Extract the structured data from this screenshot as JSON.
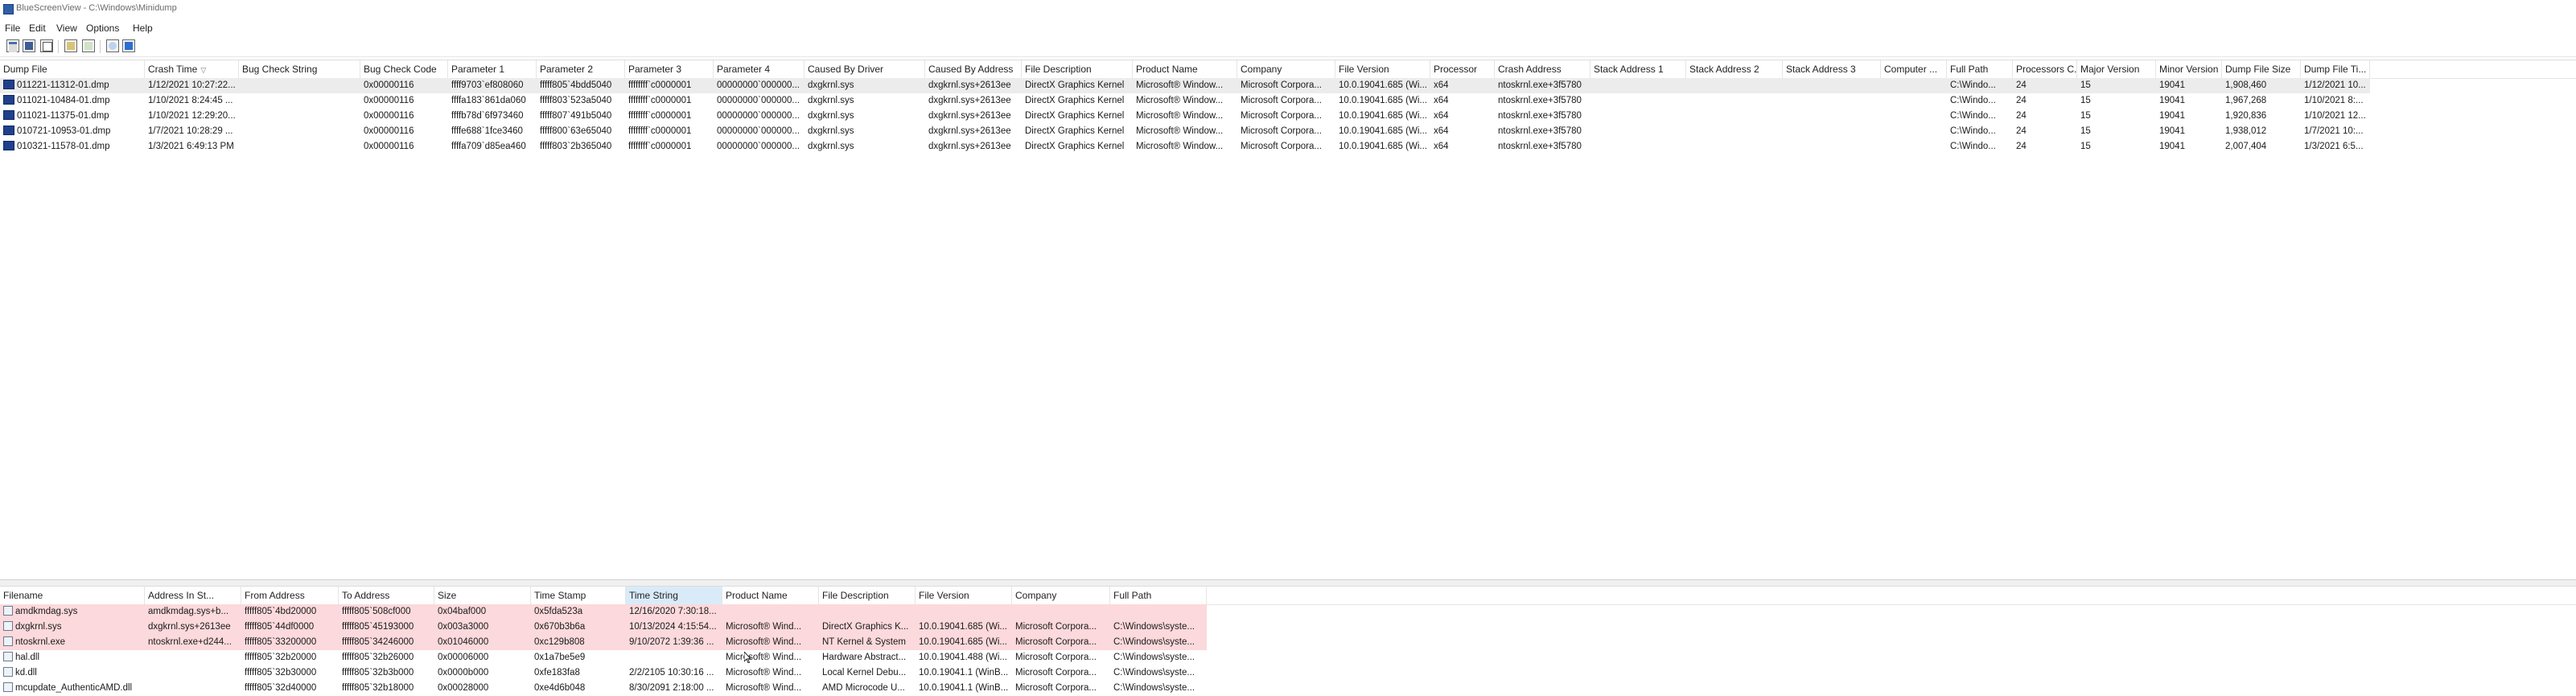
{
  "window": {
    "title": "BlueScreenView  -  C:\\Windows\\Minidump"
  },
  "menu": [
    "File",
    "Edit",
    "View",
    "Options",
    "Help"
  ],
  "toolbar": {
    "icons": [
      "properties-icon",
      "save-icon",
      "copy-icon",
      "html-report-icon",
      "refresh-icon",
      "find-icon",
      "about-icon"
    ]
  },
  "top_table": {
    "sort_column": "Crash Time",
    "columns": [
      "Dump File",
      "Crash Time",
      "Bug Check String",
      "Bug Check Code",
      "Parameter 1",
      "Parameter 2",
      "Parameter 3",
      "Parameter 4",
      "Caused By Driver",
      "Caused By Address",
      "File Description",
      "Product Name",
      "Company",
      "File Version",
      "Processor",
      "Crash Address",
      "Stack Address 1",
      "Stack Address 2",
      "Stack Address 3",
      "Computer ...",
      "Full Path",
      "Processors C...",
      "Major Version",
      "Minor Version",
      "Dump File Size",
      "Dump File Ti..."
    ],
    "rows": [
      [
        "011221-11312-01.dmp",
        "1/12/2021 10:27:22...",
        "",
        "0x00000116",
        "ffff9703`ef808060",
        "fffff805`4bdd5040",
        "ffffffff`c0000001",
        "00000000`000000...",
        "dxgkrnl.sys",
        "dxgkrnl.sys+2613ee",
        "DirectX Graphics Kernel",
        "Microsoft® Window...",
        "Microsoft Corpora...",
        "10.0.19041.685 (Wi...",
        "x64",
        "ntoskrnl.exe+3f5780",
        "",
        "",
        "",
        "",
        "C:\\Windo...",
        "24",
        "15",
        "19041",
        "1,908,460",
        "1/12/2021 10..."
      ],
      [
        "011021-10484-01.dmp",
        "1/10/2021 8:24:45 ...",
        "",
        "0x00000116",
        "ffffa183`861da060",
        "fffff803`523a5040",
        "ffffffff`c0000001",
        "00000000`000000...",
        "dxgkrnl.sys",
        "dxgkrnl.sys+2613ee",
        "DirectX Graphics Kernel",
        "Microsoft® Window...",
        "Microsoft Corpora...",
        "10.0.19041.685 (Wi...",
        "x64",
        "ntoskrnl.exe+3f5780",
        "",
        "",
        "",
        "",
        "C:\\Windo...",
        "24",
        "15",
        "19041",
        "1,967,268",
        "1/10/2021 8:..."
      ],
      [
        "011021-11375-01.dmp",
        "1/10/2021 12:29:20...",
        "",
        "0x00000116",
        "ffffb78d`6f973460",
        "fffff807`491b5040",
        "ffffffff`c0000001",
        "00000000`000000...",
        "dxgkrnl.sys",
        "dxgkrnl.sys+2613ee",
        "DirectX Graphics Kernel",
        "Microsoft® Window...",
        "Microsoft Corpora...",
        "10.0.19041.685 (Wi...",
        "x64",
        "ntoskrnl.exe+3f5780",
        "",
        "",
        "",
        "",
        "C:\\Windo...",
        "24",
        "15",
        "19041",
        "1,920,836",
        "1/10/2021 12..."
      ],
      [
        "010721-10953-01.dmp",
        "1/7/2021 10:28:29 ...",
        "",
        "0x00000116",
        "ffffe688`1fce3460",
        "fffff800`63e65040",
        "ffffffff`c0000001",
        "00000000`000000...",
        "dxgkrnl.sys",
        "dxgkrnl.sys+2613ee",
        "DirectX Graphics Kernel",
        "Microsoft® Window...",
        "Microsoft Corpora...",
        "10.0.19041.685 (Wi...",
        "x64",
        "ntoskrnl.exe+3f5780",
        "",
        "",
        "",
        "",
        "C:\\Windo...",
        "24",
        "15",
        "19041",
        "1,938,012",
        "1/7/2021 10:..."
      ],
      [
        "010321-11578-01.dmp",
        "1/3/2021 6:49:13 PM",
        "",
        "0x00000116",
        "ffffa709`d85ea460",
        "fffff803`2b365040",
        "ffffffff`c0000001",
        "00000000`000000...",
        "dxgkrnl.sys",
        "dxgkrnl.sys+2613ee",
        "DirectX Graphics Kernel",
        "Microsoft® Window...",
        "Microsoft Corpora...",
        "10.0.19041.685 (Wi...",
        "x64",
        "ntoskrnl.exe+3f5780",
        "",
        "",
        "",
        "",
        "C:\\Windo...",
        "24",
        "15",
        "19041",
        "2,007,404",
        "1/3/2021 6:5..."
      ]
    ]
  },
  "bottom_table": {
    "sort_column": "Time String",
    "columns": [
      "Filename",
      "Address In St...",
      "From Address",
      "To Address",
      "Size",
      "Time Stamp",
      "Time String",
      "Product Name",
      "File Description",
      "File Version",
      "Company",
      "Full Path"
    ],
    "rows": [
      [
        "amdkmdag.sys",
        "amdkmdag.sys+b...",
        "fffff805`4bd20000",
        "fffff805`508cf000",
        "0x04baf000",
        "0x5fda523a",
        "12/16/2020 7:30:18...",
        "",
        "",
        "",
        "",
        ""
      ],
      [
        "dxgkrnl.sys",
        "dxgkrnl.sys+2613ee",
        "fffff805`44df0000",
        "fffff805`45193000",
        "0x003a3000",
        "0x670b3b6a",
        "10/13/2024 4:15:54...",
        "Microsoft® Wind...",
        "DirectX Graphics K...",
        "10.0.19041.685 (Wi...",
        "Microsoft Corpora...",
        "C:\\Windows\\syste..."
      ],
      [
        "ntoskrnl.exe",
        "ntoskrnl.exe+d244...",
        "fffff805`33200000",
        "fffff805`34246000",
        "0x01046000",
        "0xc129b808",
        "9/10/2072 1:39:36 ...",
        "Microsoft® Wind...",
        "NT Kernel & System",
        "10.0.19041.685 (Wi...",
        "Microsoft Corpora...",
        "C:\\Windows\\syste..."
      ],
      [
        "hal.dll",
        "",
        "fffff805`32b20000",
        "fffff805`32b26000",
        "0x00006000",
        "0x1a7be5e9",
        "",
        "Microsoft® Wind...",
        "Hardware Abstract...",
        "10.0.19041.488 (Wi...",
        "Microsoft Corpora...",
        "C:\\Windows\\syste..."
      ],
      [
        "kd.dll",
        "",
        "fffff805`32b30000",
        "fffff805`32b3b000",
        "0x0000b000",
        "0xfe183fa8",
        "2/2/2105 10:30:16 ...",
        "Microsoft® Wind...",
        "Local Kernel Debu...",
        "10.0.19041.1 (WinB...",
        "Microsoft Corpora...",
        "C:\\Windows\\syste..."
      ],
      [
        "mcupdate_AuthenticAMD.dll",
        "",
        "fffff805`32d40000",
        "fffff805`32b18000",
        "0x00028000",
        "0xe4d6b048",
        "8/30/2091 2:18:00 ...",
        "Microsoft® Wind...",
        "AMD Microcode U...",
        "10.0.19041.1 (WinB...",
        "Microsoft Corpora...",
        "C:\\Windows\\syste..."
      ]
    ],
    "row_highlight": [
      "pink",
      "pink",
      "pink",
      "white",
      "white",
      "white"
    ]
  }
}
